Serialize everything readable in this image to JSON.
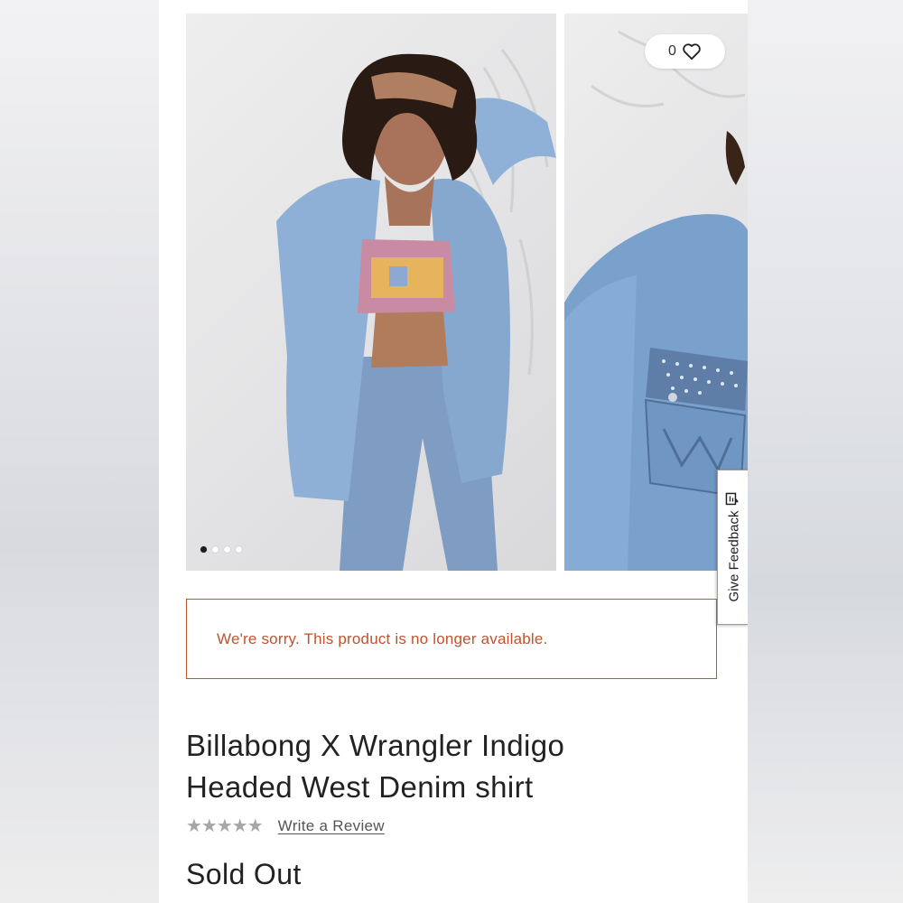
{
  "gallery": {
    "photos": [
      {
        "icon": "model-wearing-denim-shirt-photo"
      },
      {
        "icon": "denim-pocket-closeup-photo"
      }
    ],
    "dot_count": 4,
    "active_dot": 0
  },
  "wishlist": {
    "count": "0",
    "icon": "heart-icon"
  },
  "feedback": {
    "label": "Give Feedback",
    "icon": "feedback-icon"
  },
  "alert": {
    "message": "We're sorry. This product is no longer available.",
    "color": "#c0532c"
  },
  "product": {
    "title_line1": "Billabong X Wrangler Indigo",
    "title_line2": "Headed West Denim shirt",
    "rating_stars": "★★★★★",
    "rating_value": 0,
    "review_link": "Write a Review",
    "status": "Sold Out"
  }
}
